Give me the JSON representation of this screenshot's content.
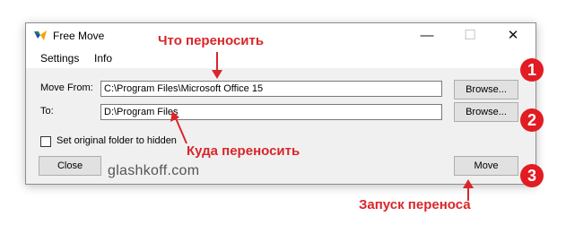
{
  "window": {
    "title": "Free Move",
    "controls": {
      "minimize": "—",
      "maximize": "☐",
      "close": "✕"
    }
  },
  "menu": {
    "settings": "Settings",
    "info": "Info"
  },
  "form": {
    "move_from_label": "Move From:",
    "move_from_value": "C:\\Program Files\\Microsoft Office 15",
    "to_label": "To:",
    "to_value": "D:\\Program Files",
    "browse_label": "Browse...",
    "checkbox_label": "Set original folder to hidden",
    "checkbox_checked": false,
    "close_label": "Close",
    "move_label": "Move"
  },
  "annotations": {
    "what_to_move": "Что переносить",
    "where_to_move": "Куда переносить",
    "start_move": "Запуск переноса",
    "badges": [
      "1",
      "2",
      "3"
    ],
    "watermark": "glashkoff.com",
    "accent_color": "#e11c22"
  }
}
